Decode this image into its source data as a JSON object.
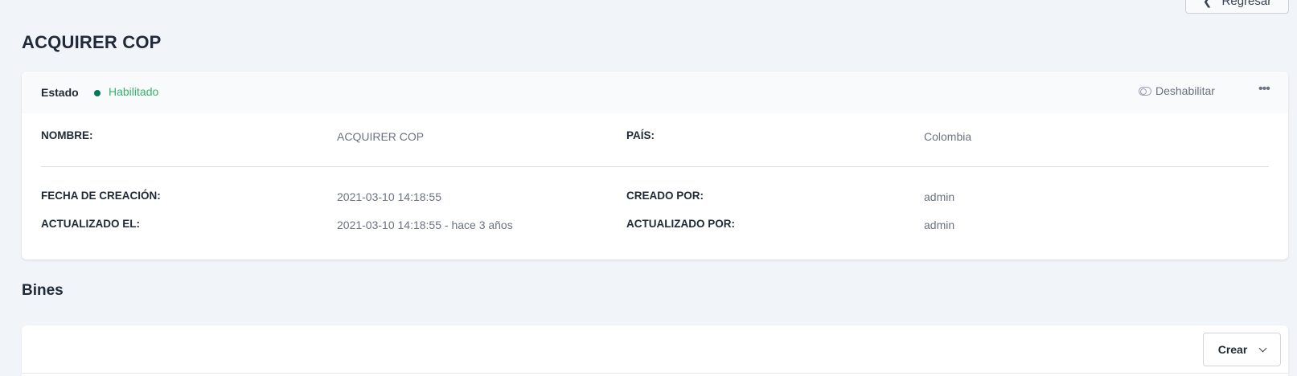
{
  "header": {
    "back_label": "Regresar",
    "title": "ACQUIRER COP"
  },
  "status": {
    "label": "Estado",
    "value": "Habilitado",
    "disable_action": "Deshabilitar",
    "status_color": "#34b36b",
    "dot_color": "#047857"
  },
  "details": {
    "name_label": "NOMBRE:",
    "name_value": "ACQUIRER COP",
    "country_label": "PAÍS:",
    "country_value": "Colombia",
    "created_at_label": "FECHA DE CREACIÓN:",
    "created_at_value": "2021-03-10 14:18:55",
    "created_by_label": "CREADO POR:",
    "created_by_value": "admin",
    "updated_at_label": "ACTUALIZADO EL:",
    "updated_at_value": "2021-03-10 14:18:55 - hace 3 años",
    "updated_by_label": "ACTUALIZADO POR:",
    "updated_by_value": "admin"
  },
  "bins": {
    "title": "Bines",
    "create_label": "Crear"
  },
  "icons": {
    "back": "arrow-left-icon",
    "toggle": "toggle-off-icon",
    "more": "more-horizontal-icon",
    "chevron": "chevron-down-icon"
  }
}
